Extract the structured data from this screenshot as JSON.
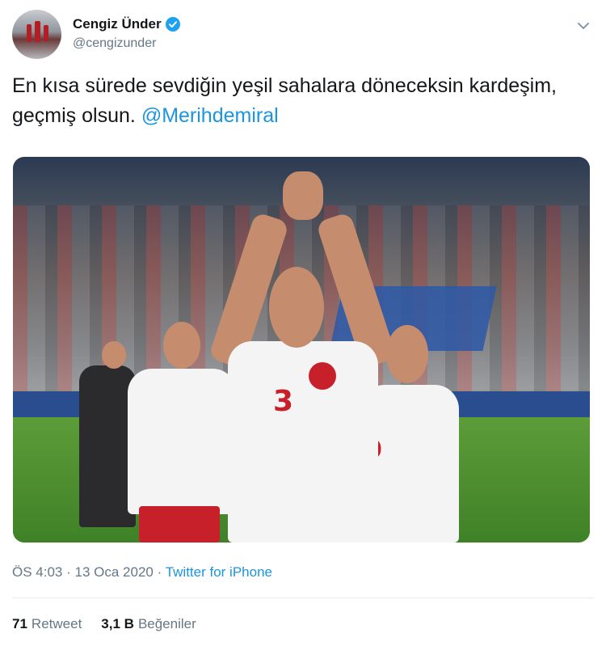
{
  "user": {
    "name": "Cengiz Ünder",
    "handle": "@cengizunder",
    "verified": true,
    "avatar_icon": "profile-photo"
  },
  "tweet": {
    "text": "En kısa sürede sevdiğin yeşil sahalara döneceksin kardeşim, geçmiş olsun.",
    "mention": "@Merihdemiral"
  },
  "photo": {
    "jersey_number": "3",
    "jersey_number_right": "0"
  },
  "meta": {
    "time": "ÖS 4:03",
    "date": "13 Oca 2020",
    "separator": "·",
    "source": "Twitter for iPhone"
  },
  "stats": {
    "retweets_count": "71",
    "retweets_label": "Retweet",
    "likes_count": "3,1 B",
    "likes_label": "Beğeniler"
  },
  "colors": {
    "link": "#1b95e0",
    "verified": "#1da1f2",
    "secondary_text": "#657786"
  }
}
